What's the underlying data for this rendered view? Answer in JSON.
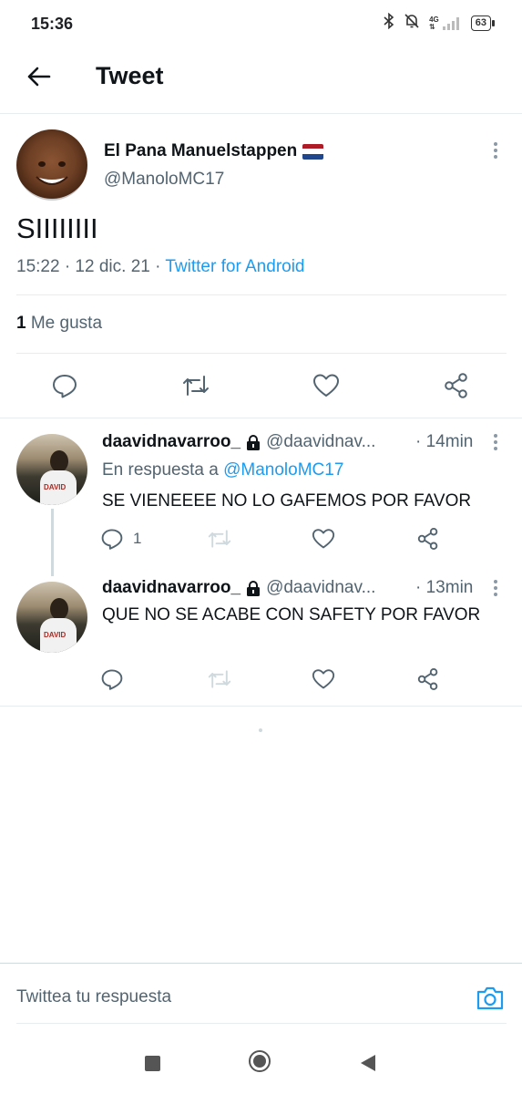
{
  "status_bar": {
    "time": "15:36",
    "network_label": "4G",
    "battery_level": "63",
    "icons": [
      "bluetooth-icon",
      "bell-off-icon",
      "signal-icon",
      "battery-icon"
    ]
  },
  "header": {
    "title": "Tweet"
  },
  "tweet": {
    "author_name": "El Pana Manuelstappen",
    "author_handle": "@ManoloMC17",
    "text": "SIIIIIIII",
    "time_date": "15:22 · 12 dic. 21 · ",
    "source": "Twitter for Android",
    "like_count": "1",
    "like_label": "Me gusta"
  },
  "replies": [
    {
      "name": "daavidnavarroo_",
      "handle": "@daavidnav...",
      "time": "· 14min",
      "replying_prefix": "En respuesta a ",
      "replying_to": "@ManoloMC17",
      "text": "SE VIENEEEE NO LO GAFEMOS POR FAVOR",
      "reply_count": "1"
    },
    {
      "name": "daavidnavarroo_",
      "handle": "@daavidnav...",
      "time": "· 13min",
      "text": "QUE NO SE ACABE CON SAFETY POR FAVOR"
    }
  ],
  "compose": {
    "placeholder": "Twittea tu respuesta"
  },
  "colors": {
    "accent": "#1d9bf0",
    "text_primary": "#0f1419",
    "text_secondary": "#536471",
    "divider": "#e6ecf0"
  }
}
